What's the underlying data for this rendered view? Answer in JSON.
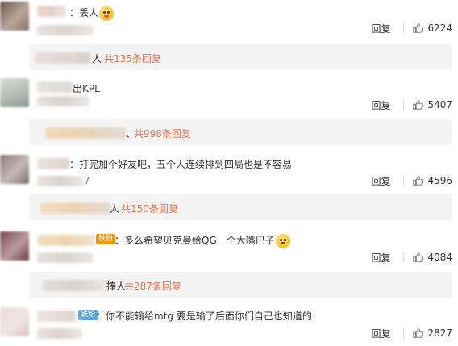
{
  "colors": {
    "orange_link": "#eb7350",
    "badge_orange": "#f39800",
    "badge_blue": "#5aa9e6"
  },
  "comments": [
    {
      "text": "：丢人",
      "reply_label": "回复",
      "likes": "6224",
      "replies_prefix": "人",
      "replies_count": "共135条回复"
    },
    {
      "text": "出KPL",
      "reply_label": "回复",
      "likes": "5407",
      "replies_prefix": "、",
      "replies_count": "共998条回复"
    },
    {
      "text": "：打完加个好友吧，五个人连续排到四局也是不容易",
      "sub_text": "7",
      "reply_label": "回复",
      "likes": "4596",
      "replies_prefix": "人",
      "replies_count": "共150条回复"
    },
    {
      "badge": "铁粉",
      "text": "：多么希望贝克曼给QG一个大嘴巴子",
      "reply_label": "回复",
      "likes": "4084",
      "replies_prefix": "捧人",
      "replies_count": "共287条回复"
    },
    {
      "badge": "铁粉",
      "text": "：你不能输给mtg 要是输了后面你们自己也知道的",
      "reply_label": "回复",
      "likes": "2827"
    }
  ]
}
